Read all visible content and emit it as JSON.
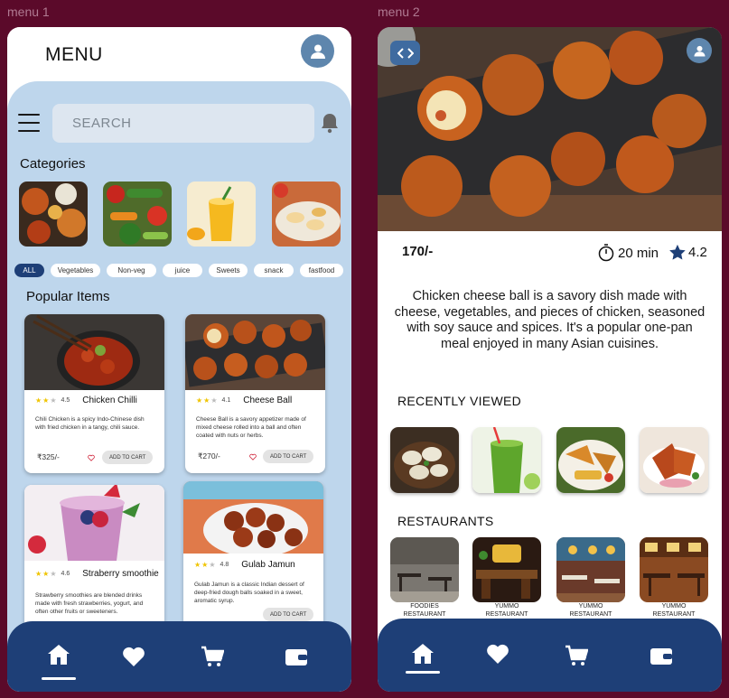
{
  "frames": {
    "menu1_label": "menu 1",
    "menu2_label": "menu 2"
  },
  "menu1": {
    "title": "MENU",
    "search_placeholder": "SEARCH",
    "categories_title": "Categories",
    "category_images": [
      "curry-thali-image",
      "vegetables-image",
      "mango-lassi-image",
      "sweets-image"
    ],
    "chips": [
      {
        "label": "ALL",
        "active": true
      },
      {
        "label": "Vegetables",
        "active": false
      },
      {
        "label": "Non-veg",
        "active": false
      },
      {
        "label": "juice",
        "active": false
      },
      {
        "label": "Sweets",
        "active": false
      },
      {
        "label": "snack",
        "active": false
      },
      {
        "label": "fastfood",
        "active": false
      }
    ],
    "popular_title": "Popular Items",
    "items": [
      {
        "name": "Chicken Chilli",
        "rating": "4.5",
        "stars": 2,
        "desc": "Chili Chicken is a spicy Indo-Chinese dish with fried chicken in a tangy, chili sauce.",
        "price": "₹325/-",
        "cta": "ADD TO CART"
      },
      {
        "name": "Cheese Ball",
        "rating": "4.1",
        "stars": 2,
        "desc": "Cheese Ball is a savory appetizer made of mixed cheese rolled into a ball and often coated with nuts or herbs.",
        "price": "₹270/-",
        "cta": "ADD TO CART"
      },
      {
        "name": "Straberry smoothie",
        "rating": "4.6",
        "stars": 2,
        "desc": "Strawberry smoothies are blended drinks made with fresh strawberries, yogurt, and often other fruits or sweeteners.",
        "price": "",
        "cta": ""
      },
      {
        "name": "Gulab Jamun",
        "rating": "4.8",
        "stars": 2,
        "desc": "Gulab Jamun is a classic Indian dessert of deep-fried dough balls soaked in a sweet, aromatic syrup.",
        "price": "",
        "cta": "ADD TO CART"
      }
    ],
    "nav": [
      "home-icon",
      "heart-icon",
      "cart-icon",
      "wallet-icon"
    ]
  },
  "menu2": {
    "price": "170/-",
    "time": "20 min",
    "rating": "4.2",
    "description": "Chicken cheese ball is a savory dish made with cheese, vegetables, and pieces of chicken, seasoned with soy sauce and spices. It's a popular one-pan meal enjoyed in many Asian cuisines.",
    "recent_title": "RECENTLY VIEWED",
    "recent_images": [
      "momos-image",
      "green-juice-image",
      "fried-chicken-plate-image",
      "grilled-chicken-image"
    ],
    "restaurants_title": "RESTAURANTS",
    "restaurants": [
      {
        "line1": "FOODIES",
        "line2": "RESTAURANT"
      },
      {
        "line1": "YUMMO",
        "line2": "RESTAURANT"
      },
      {
        "line1": "YUMMO",
        "line2": "RESTAURANT"
      },
      {
        "line1": "YUMMO",
        "line2": "RESTAURANT"
      }
    ],
    "nav": [
      "home-icon",
      "heart-icon",
      "cart-icon",
      "wallet-icon"
    ]
  },
  "colors": {
    "background": "#5b0a2a",
    "panel": "#bed6ec",
    "navy": "#1e3f77",
    "star": "#f0c400",
    "avatar": "#5e86ad"
  }
}
